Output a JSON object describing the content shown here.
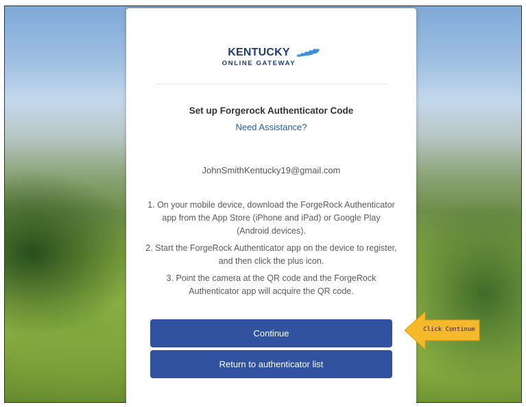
{
  "logo": {
    "line1": "KENTUCKY",
    "line2": "ONLINE GATEWAY",
    "brand_color": "#1d3c7a",
    "icon": "kentucky-state-shape-icon"
  },
  "heading": "Set up Forgerock Authenticator Code",
  "assistance_link": "Need Assistance?",
  "email": "JohnSmithKentucky19@gmail.com",
  "steps": [
    "1. On your mobile device, download the ForgeRock Authenticator app from the App Store (iPhone and iPad) or Google Play (Android devices).",
    "2. Start the ForgeRock Authenticator app on the device to register, and then click the plus icon.",
    "3. Point the camera at the QR code and the ForgeRock Authenticator app will acquire the QR code."
  ],
  "buttons": {
    "continue": "Continue",
    "return": "Return to authenticator list"
  },
  "callout": {
    "text": "Click Continue",
    "color": "#f5b92a"
  },
  "colors": {
    "button": "#30529f",
    "link": "#1f5cb0"
  }
}
